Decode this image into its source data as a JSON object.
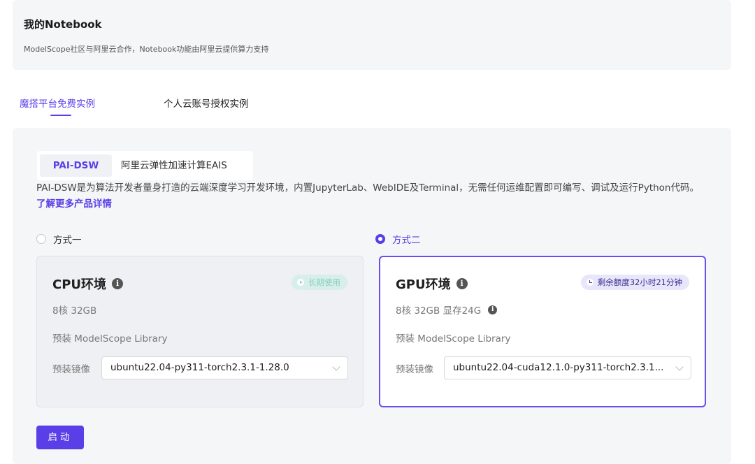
{
  "header": {
    "title": "我的Notebook",
    "subtitle": "ModelScope社区与阿里云合作，Notebook功能由阿里云提供算力支持"
  },
  "tabs": [
    {
      "label": "魔搭平台免费实例",
      "active": true
    },
    {
      "label": "个人云账号授权实例",
      "active": false
    }
  ],
  "segments": [
    {
      "label": "PAI-DSW",
      "active": true
    },
    {
      "label": "阿里云弹性加速计算EAIS",
      "active": false
    }
  ],
  "description": {
    "text": "PAI-DSW是为算法开发者量身打造的云端深度学习开发环境，内置JupyterLab、WebIDE及Terminal，无需任何运维配置即可编写、调试及运行Python代码。",
    "link": "了解更多产品详情"
  },
  "options": [
    {
      "label": "方式一",
      "selected": false
    },
    {
      "label": "方式二",
      "selected": true
    }
  ],
  "cpu": {
    "title": "CPU环境",
    "badge": "长期使用",
    "spec": "8核 32GB",
    "library": "预装 ModelScope Library",
    "image_label": "预装镜像",
    "image_value": "ubuntu22.04-py311-torch2.3.1-1.28.0"
  },
  "gpu": {
    "title": "GPU环境",
    "badge": "剩余额度32小时21分钟",
    "spec": "8核 32GB 显存24G",
    "library": "预装 ModelScope Library",
    "image_label": "预装镜像",
    "image_value": "ubuntu22.04-cuda12.1.0-py311-torch2.3.1..."
  },
  "start_button": "启动",
  "colors": {
    "accent": "#5a3ee8",
    "panel": "#f5f6f8"
  }
}
